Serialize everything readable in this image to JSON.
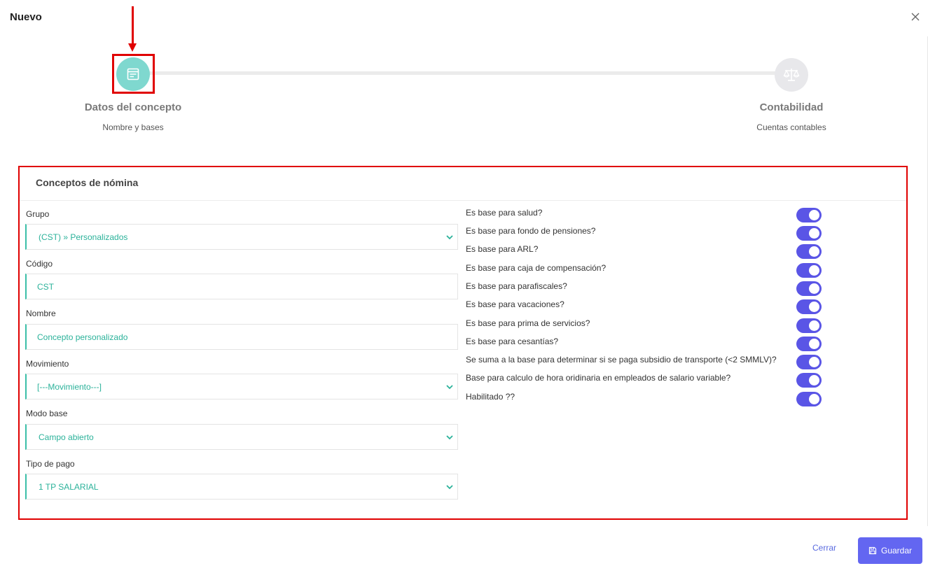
{
  "modal": {
    "title": "Nuevo"
  },
  "stepper": {
    "steps": [
      {
        "title": "Datos del concepto",
        "subtitle": "Nombre y bases",
        "icon": "form-icon",
        "color": "#7fd8cf"
      },
      {
        "title": "Contabilidad",
        "subtitle": "Cuentas contables",
        "icon": "scale-icon",
        "color": "#e8e8eb"
      }
    ]
  },
  "card": {
    "title": "Conceptos de nómina",
    "fields": [
      {
        "label": "Grupo",
        "value": "(CST) » Personalizados",
        "type": "select"
      },
      {
        "label": "Código",
        "value": "CST",
        "type": "input"
      },
      {
        "label": "Nombre",
        "value": "Concepto personalizado",
        "type": "input"
      },
      {
        "label": "Movimiento",
        "value": "[---Movimiento---]",
        "type": "select"
      },
      {
        "label": "Modo base",
        "value": "Campo abierto",
        "type": "select"
      },
      {
        "label": "Tipo de pago",
        "value": "1 TP SALARIAL",
        "type": "select"
      }
    ],
    "toggles": [
      {
        "label": "Es base para salud?",
        "on": true
      },
      {
        "label": "Es base para fondo de pensiones?",
        "on": true
      },
      {
        "label": "Es base para ARL?",
        "on": true
      },
      {
        "label": "Es base para caja de compensación?",
        "on": true
      },
      {
        "label": "Es base para parafiscales?",
        "on": true
      },
      {
        "label": "Es base para vacaciones?",
        "on": true
      },
      {
        "label": "Es base para prima de servicios?",
        "on": true
      },
      {
        "label": "Es base para cesantías?",
        "on": true
      },
      {
        "label": "Se suma a la base para determinar si se paga subsidio de transporte (<2 SMMLV)?",
        "on": true
      },
      {
        "label": "Base para calculo de hora oridinaria en empleados de salario variable?",
        "on": true
      },
      {
        "label": "Habilitado ??",
        "on": true
      }
    ]
  },
  "footer": {
    "cancel_label": "Cerrar",
    "save_label": "Guardar"
  },
  "colors": {
    "accent": "#6366f1",
    "toggle": "#5a55e6",
    "field_text": "#2bb29a",
    "highlight": "#e00000"
  }
}
